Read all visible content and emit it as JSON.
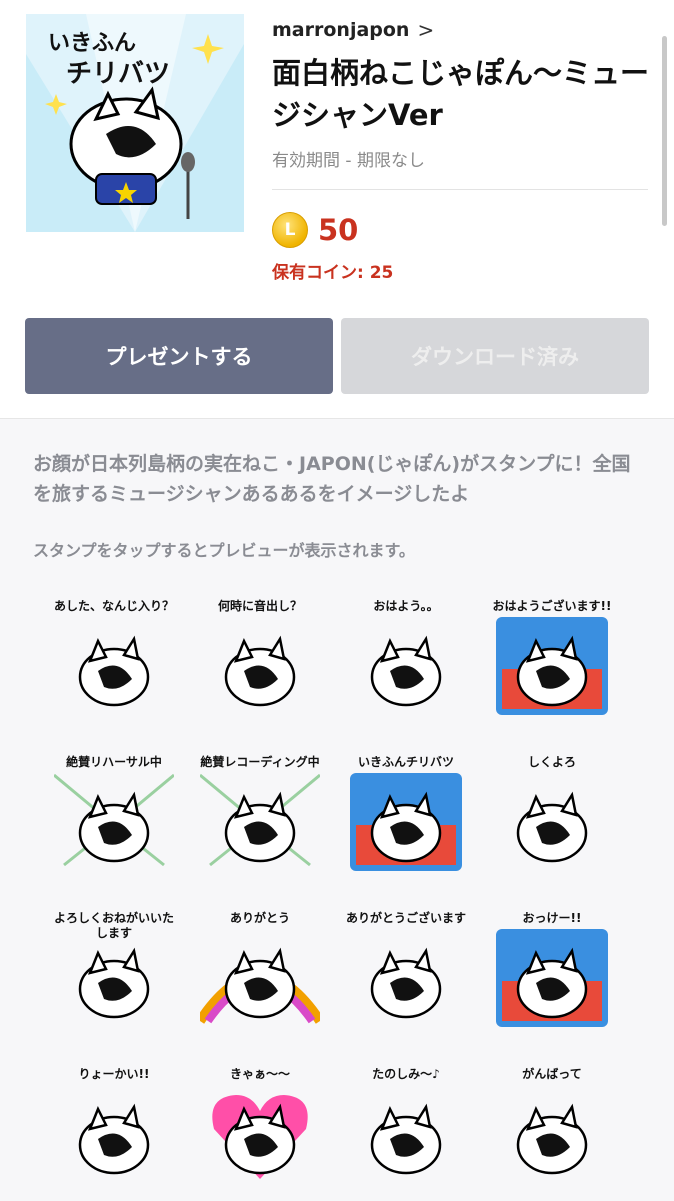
{
  "product": {
    "author": "marronjapon",
    "title": "面白柄ねこじゃぽん〜ミュージシャンVer",
    "validity": "有効期間 - 期限なし",
    "coin_icon": "L",
    "price": "50",
    "owned_coins": "保有コイン: 25"
  },
  "cover": {
    "caption_line1": "いきふん",
    "caption_line2": "チリバツ"
  },
  "buttons": {
    "present": "プレゼントする",
    "download": "ダウンロード済み"
  },
  "description": "お顔が日本列島柄の実在ねこ・JAPON(じゃぽん)がスタンプに！全国を旅するミュージシャンあるあるをイメージしたよ",
  "hint": "スタンプをタップするとプレビューが表示されます。",
  "colors": {
    "accent_red": "#c9321f",
    "present_button": "#676e87",
    "disabled_button": "#d6d7da"
  },
  "stickers": [
    {
      "caption": "あした、なんじ入り？",
      "bg": "none"
    },
    {
      "caption": "何時に音出し？",
      "bg": "none"
    },
    {
      "caption": "おはよう。。",
      "bg": "none"
    },
    {
      "caption": "おはようございます!!",
      "bg": "sky"
    },
    {
      "caption": "絶賛リハーサル中",
      "bg": "rays"
    },
    {
      "caption": "絶賛レコーディング中",
      "bg": "rays"
    },
    {
      "caption": "いきふんチリバツ",
      "bg": "sky"
    },
    {
      "caption": "しくよろ",
      "bg": "none"
    },
    {
      "caption": "よろしくおねがいいたします",
      "bg": "none"
    },
    {
      "caption": "ありがとう",
      "bg": "rainbow"
    },
    {
      "caption": "ありがとうございます",
      "bg": "none"
    },
    {
      "caption": "おっけー!!",
      "bg": "sky"
    },
    {
      "caption": "りょーかい!!",
      "bg": "none"
    },
    {
      "caption": "きゃぁ〜〜",
      "bg": "heart"
    },
    {
      "caption": "たのしみ〜♪",
      "bg": "none"
    },
    {
      "caption": "がんばって",
      "bg": "none"
    }
  ]
}
